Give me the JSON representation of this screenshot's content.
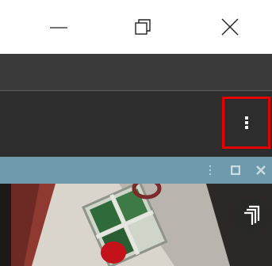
{
  "window_controls": {
    "minimize_icon": "minimize-icon",
    "restore_icon": "restore-icon",
    "close_icon": "close-icon"
  },
  "toolbar": {
    "menu_icon": "kebab-menu-icon",
    "highlight_color": "#e40000"
  },
  "panel": {
    "header_color": "#6f9aab",
    "controls": [
      "vertical-dots-icon",
      "maximize-icon",
      "close-icon"
    ]
  },
  "photo": {
    "description_icon": "camera-feed-image"
  },
  "floating_button": {
    "icon": "stacked-layers-icon"
  }
}
